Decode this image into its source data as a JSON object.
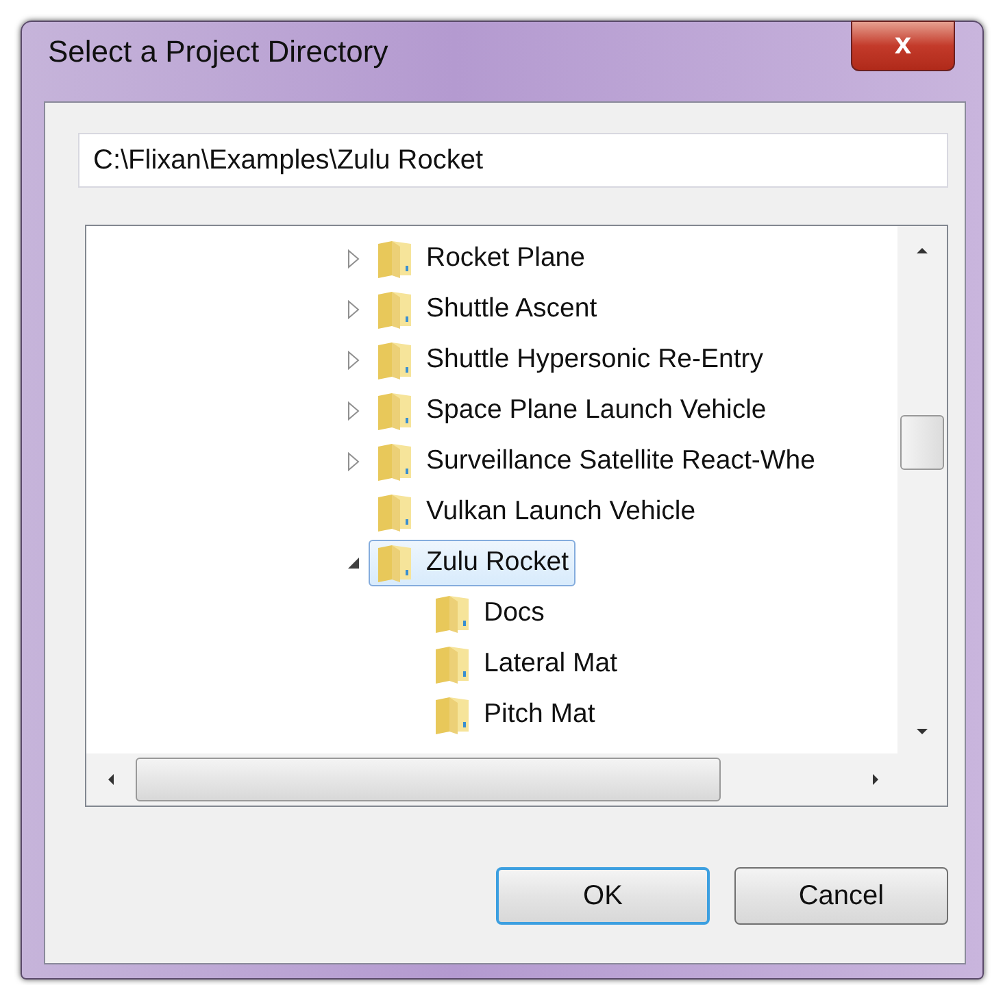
{
  "window": {
    "title": "Select a Project Directory",
    "close_label": "x"
  },
  "path_field": {
    "value": "C:\\Flixan\\Examples\\Zulu Rocket"
  },
  "tree": [
    {
      "label": "Rocket Plane",
      "kind": "folder",
      "expanded": false,
      "selected": false
    },
    {
      "label": "Shuttle Ascent",
      "kind": "folder",
      "expanded": false,
      "selected": false
    },
    {
      "label": "Shuttle Hypersonic Re-Entry",
      "kind": "folder",
      "expanded": false,
      "selected": false
    },
    {
      "label": "Space Plane Launch Vehicle",
      "kind": "folder",
      "expanded": false,
      "selected": false
    },
    {
      "label": "Surveillance Satellite React-Whe",
      "kind": "folder",
      "expanded": false,
      "selected": false
    },
    {
      "label": "Vulkan Launch Vehicle",
      "kind": "leaf",
      "selected": false
    },
    {
      "label": "Zulu Rocket",
      "kind": "folder",
      "expanded": true,
      "selected": true,
      "children": [
        {
          "label": "Docs",
          "selected": false
        },
        {
          "label": "Lateral Mat",
          "selected": false
        },
        {
          "label": "Pitch Mat",
          "selected": false
        }
      ]
    }
  ],
  "buttons": [
    {
      "label": "OK",
      "default": true
    },
    {
      "label": "Cancel",
      "default": false
    }
  ]
}
